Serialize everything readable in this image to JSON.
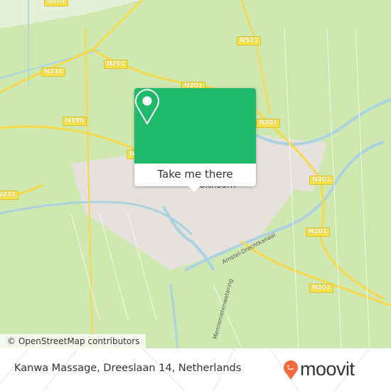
{
  "map": {
    "road_labels": [
      "N201",
      "N521",
      "N231",
      "N201",
      "N201",
      "N196",
      "N201",
      "N201",
      "N201",
      "N201",
      "N231",
      "N1"
    ],
    "canal_labels": [
      "Amstel-Drechtkanaal",
      "Mennonietenwetering"
    ],
    "town_label": "Uithoorn",
    "attribution": "© OpenStreetMap contributors",
    "colors": {
      "land": "#cfe8b0",
      "water": "#aad3df",
      "road": "#f6e24a",
      "urban": "#e8e0e0"
    }
  },
  "popup": {
    "icon": "map-pin-icon",
    "button_label": "Take me there",
    "color": "#1fb96c"
  },
  "footer": {
    "address": "Kanwa Massage, Dreeslaan 14, Netherlands",
    "logo_text": "moovit",
    "logo_color": "#f26a3d"
  }
}
